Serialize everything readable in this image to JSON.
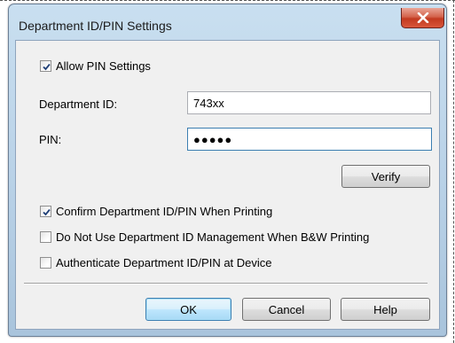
{
  "window": {
    "title": "Department ID/PIN Settings",
    "close_icon": "close-icon"
  },
  "allow_pin": {
    "label": "Allow PIN Settings",
    "checked": true
  },
  "department_id": {
    "label": "Department ID:",
    "value": "743xx"
  },
  "pin": {
    "label": "PIN:",
    "masked_value": "●●●●●"
  },
  "verify_button": "Verify",
  "options": [
    {
      "label": "Confirm Department ID/PIN When Printing",
      "checked": true
    },
    {
      "label": "Do Not Use Department ID Management When B&W Printing",
      "checked": false
    },
    {
      "label": "Authenticate Department ID/PIN at Device",
      "checked": false
    }
  ],
  "buttons": {
    "ok": "OK",
    "cancel": "Cancel",
    "help": "Help"
  },
  "colors": {
    "close_button": "#c23a20",
    "default_button_border": "#3c7fb1"
  }
}
